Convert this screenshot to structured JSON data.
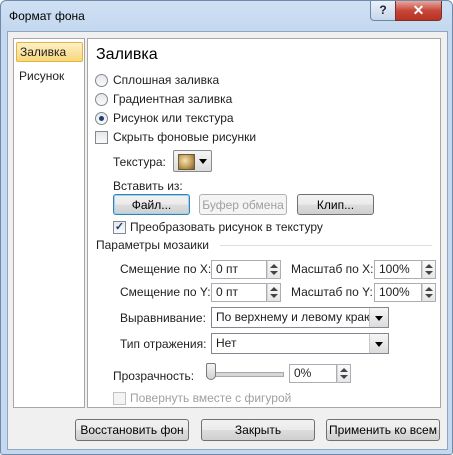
{
  "window": {
    "title": "Формат фона",
    "help": "?",
    "close": "✕"
  },
  "nav": {
    "items": [
      {
        "label": "Заливка",
        "selected": true
      },
      {
        "label": "Рисунок",
        "selected": false
      }
    ]
  },
  "fill": {
    "heading": "Заливка",
    "options": [
      {
        "label": "Сплошная заливка",
        "checked": false
      },
      {
        "label": "Градиентная заливка",
        "checked": false
      },
      {
        "label": "Рисунок или текстура",
        "checked": true
      }
    ],
    "hide_bg": "Скрыть фоновые рисунки",
    "texture_label": "Текстура:",
    "insert_from": "Вставить из:",
    "file_button": "Файл...",
    "clipboard_button": "Буфер обмена",
    "clip_button": "Клип...",
    "tile_checkbox": "Преобразовать рисунок в текстуру",
    "tiling_group": "Параметры мозаики",
    "offset_x_label": "Смещение по X:",
    "offset_x_value": "0 пт",
    "scale_x_label": "Масштаб по X:",
    "scale_x_value": "100%",
    "offset_y_label": "Смещение по Y:",
    "offset_y_value": "0 пт",
    "scale_y_label": "Масштаб по Y:",
    "scale_y_value": "100%",
    "alignment_label": "Выравнивание:",
    "alignment_value": "По верхнему и левому краю",
    "mirror_label": "Тип отражения:",
    "mirror_value": "Нет",
    "transparency_label": "Прозрачность:",
    "transparency_value": "0%",
    "transparency_level": 0,
    "rotate_checkbox": "Повернуть вместе с фигурой"
  },
  "footer": {
    "reset_button": "Восстановить фон",
    "close_button": "Закрыть",
    "apply_all_button": "Применить ко всем"
  }
}
